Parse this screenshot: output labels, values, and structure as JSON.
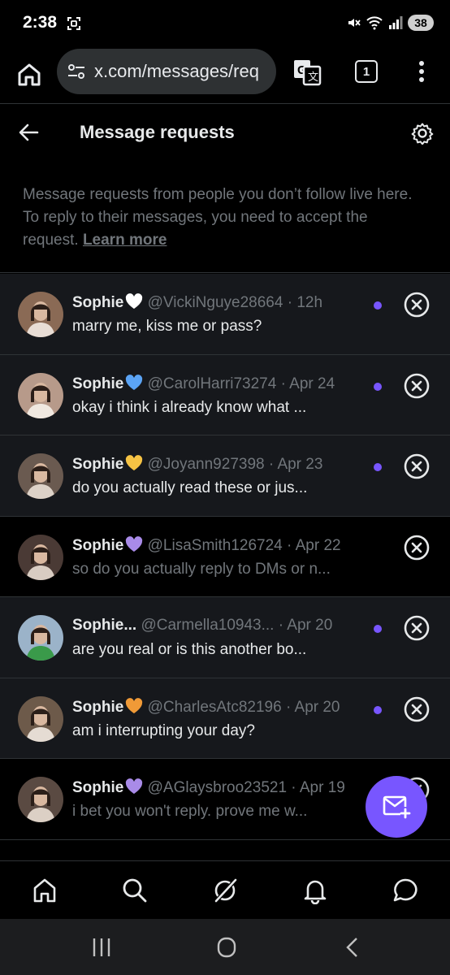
{
  "status_bar": {
    "time": "2:38",
    "battery": "38"
  },
  "browser": {
    "url": "x.com/messages/req",
    "tab_count": "1"
  },
  "header": {
    "title": "Message requests"
  },
  "info": {
    "text": "Message requests from people you don’t follow live here. To reply to their messages, you need to accept the request. ",
    "link": "Learn more"
  },
  "requests": [
    {
      "name": "Sophie",
      "heart_color": "#ffffff",
      "handle": "@VickiNguye28664",
      "time": "12h",
      "message": "marry me, kiss me or pass?",
      "unread": true
    },
    {
      "name": "Sophie",
      "heart_color": "#5ba4f5",
      "handle": "@CarolHarri73274",
      "time": "Apr 24",
      "message": "okay i think i already know what ...",
      "unread": true
    },
    {
      "name": "Sophie",
      "heart_color": "#f6c344",
      "handle": "@Joyann927398",
      "time": "Apr 23",
      "message": "do you actually read these or jus...",
      "unread": true
    },
    {
      "name": "Sophie",
      "heart_color": "#a98be8",
      "handle": "@LisaSmith126724",
      "time": "Apr 22",
      "message": "so do you actually reply to DMs or n...",
      "unread": false
    },
    {
      "name": "Sophie...",
      "heart_color": "",
      "handle": "@Carmella10943...",
      "time": "Apr 20",
      "message": "are you real or is this another bo...",
      "unread": true
    },
    {
      "name": "Sophie",
      "heart_color": "#f09a37",
      "handle": "@CharlesAtc82196",
      "time": "Apr 20",
      "message": "am i interrupting your day?",
      "unread": true
    },
    {
      "name": "Sophie",
      "heart_color": "#a98be8",
      "handle": "@AGlaysbroo23521",
      "time": "Apr 19",
      "message": "i bet you won't reply. prove me w...",
      "unread": false
    }
  ],
  "colors": {
    "accent": "#7856ff",
    "background": "#000000",
    "row_unread_bg": "#16181c",
    "muted_text": "#71767b"
  }
}
